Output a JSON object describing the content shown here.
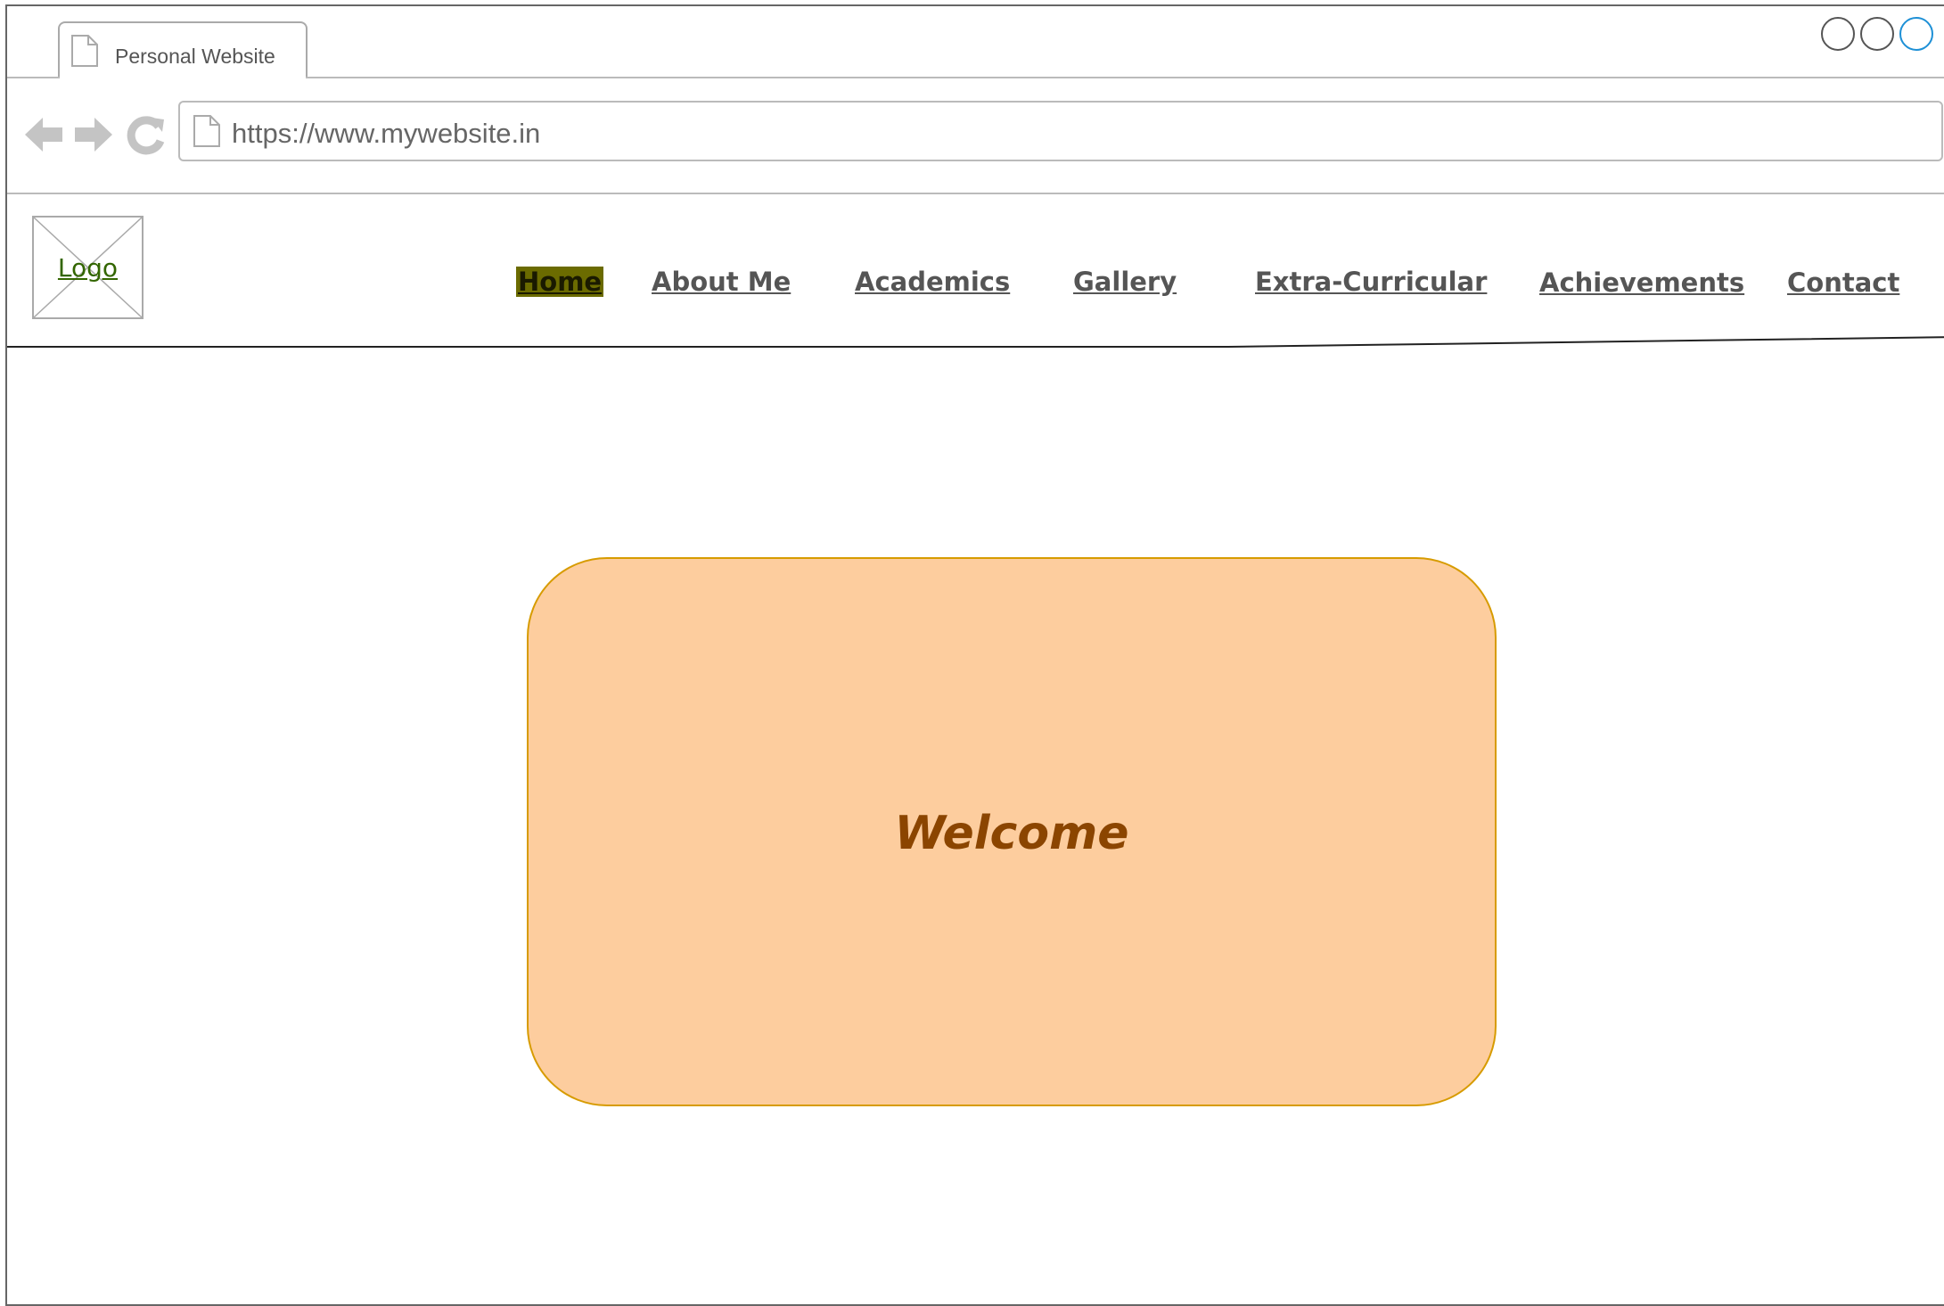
{
  "browser": {
    "tab_title": "Personal Website",
    "url": "https://www.mywebsite.in",
    "icons": [
      "back-arrow-icon",
      "forward-arrow-icon",
      "reload-icon",
      "page-icon"
    ],
    "window_control_colors": [
      "#555555",
      "#555555",
      "#1e90d6"
    ]
  },
  "site": {
    "logo_label": "Logo",
    "nav": {
      "home": "Home",
      "about": "About Me",
      "academics": "Academics",
      "gallery": "Gallery",
      "extra": "Extra-Curricular",
      "achievements": "Achievements",
      "contact": "Contact"
    },
    "active_nav": "Home"
  },
  "main": {
    "welcome_text": "Welcome"
  },
  "colors": {
    "active_nav_bg": "#6b6b00",
    "card_fill": "#fdcd9e",
    "card_border": "#d79b00",
    "welcome_text": "#8b4500"
  }
}
